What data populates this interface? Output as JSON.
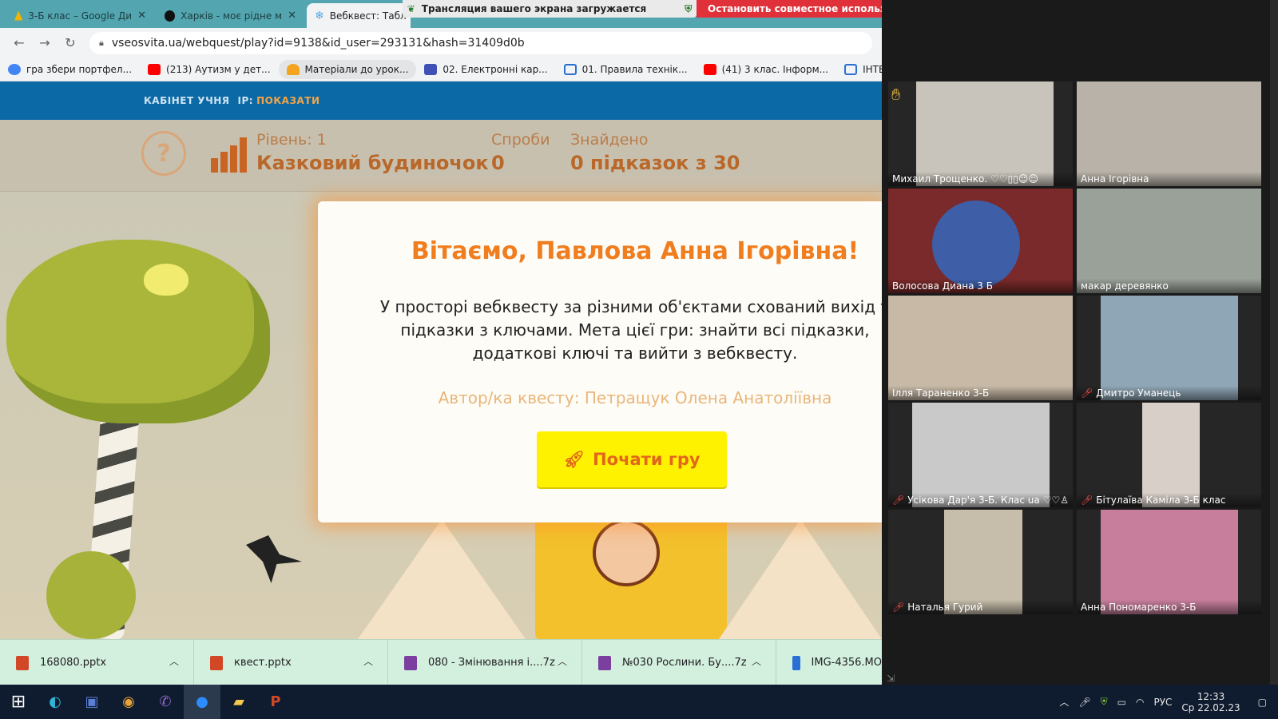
{
  "tabs": [
    {
      "label": "3-Б клас – Google Ди",
      "color": "#f2b400"
    },
    {
      "label": "Харків - моє рідне м",
      "color": "#111111"
    },
    {
      "label": "Вебквест: Табл",
      "color": "#5aa9e6"
    }
  ],
  "share_bar": {
    "text": "Трансляция вашего экрана загружается"
  },
  "stop_share": {
    "label": "Остановить совместное использова"
  },
  "omnibox": {
    "url": "vseosvita.ua/webquest/play?id=9138&id_user=293131&hash=31409d0b"
  },
  "bookmarks": [
    {
      "label": "гра збери портфел...",
      "icon": "google-icon",
      "color": "#4285f4"
    },
    {
      "label": "(213) Аутизм у дет...",
      "icon": "youtube-icon",
      "color": "#ff0000"
    },
    {
      "label": "Матеріали до урок...",
      "icon": "bell-icon",
      "color": "#f4a41e"
    },
    {
      "label": "02. Електронні кар...",
      "icon": "forms-icon",
      "color": "#3f51b5"
    },
    {
      "label": "01. Правила технік...",
      "icon": "board-icon",
      "color": "#2a6fd6"
    },
    {
      "label": "(41) 3 клас. Інформ...",
      "icon": "youtube-icon",
      "color": "#ff0000"
    },
    {
      "label": "ІНТЕРАКТИВНІ ВПР...",
      "icon": "board-icon",
      "color": "#2a6fd6"
    }
  ],
  "site_nav": {
    "cabinet": "КАБІНЕТ УЧНЯ",
    "ip_label": "IP:",
    "ip_link": "ПОКАЗАТИ"
  },
  "hud": {
    "help": "?",
    "level_label": "Рівень: 1",
    "level_name": "Казковий будиночок",
    "attempts_label": "Спроби",
    "attempts_value": "0",
    "found_label": "Знайдено",
    "found_value": "0 підказок з 30"
  },
  "modal": {
    "title": "Вітаємо, Павлова Анна Ігорівна!",
    "text": "У просторі вебквесту за різними об'єктами схований вихід т підказки з ключами. Мета цієї гри: знайти всі підказки, додаткові ключі та вийти з вебквесту.",
    "author": "Автор/ка квесту: Петращук Олена Анатоліївна",
    "start_label": "Почати гру"
  },
  "downloads": [
    {
      "name": "168080.pptx",
      "color": "#d24726"
    },
    {
      "name": "квест.pptx",
      "color": "#d24726"
    },
    {
      "name": "080 - Змінювання і....7z",
      "color": "#7b3fa0"
    },
    {
      "name": "№030 Рослини. Бу....7z",
      "color": "#7b3fa0"
    },
    {
      "name": "IMG-4356.MO",
      "color": "#2a6fd6"
    }
  ],
  "participants": [
    {
      "name": "Михаил Трощенко.",
      "extra": "♡♡▯▯☺☺",
      "muted": false,
      "hand": true,
      "bg": "#8b8f94",
      "video": "#c9c4bb"
    },
    {
      "name": "Анна Ігорівна",
      "extra": "",
      "muted": false,
      "hand": false,
      "bg": "#3b4a66",
      "video": "#b8b2a8"
    },
    {
      "name": "Волосова Диана 3 Б",
      "extra": "",
      "muted": false,
      "hand": false,
      "bg": "#7a2a2a",
      "video": "#3e5fa8"
    },
    {
      "name": "макар деревянко",
      "extra": "",
      "muted": false,
      "hand": false,
      "bg": "#6f7a73",
      "video": "#b9b8b1",
      "speaking": true
    },
    {
      "name": "Ілля Тараненко 3-Б",
      "extra": "",
      "muted": false,
      "hand": false,
      "bg": "#a89a8a",
      "video": "#c7b9a6"
    },
    {
      "name": "Дмитро Уманець",
      "extra": "",
      "muted": true,
      "hand": false,
      "bg": "#2d2d2d",
      "video": "#8fa6b6"
    },
    {
      "name": "Усікова Дар'я 3-Б. Клас ua",
      "extra": "♡♡♙",
      "muted": true,
      "hand": false,
      "bg": "#2d2d2d",
      "video": "#c9c9c9"
    },
    {
      "name": "Бітулаїва Каміла 3-Б клас",
      "extra": "",
      "muted": true,
      "hand": false,
      "bg": "#2d2d2d",
      "video": "#d8cfc9"
    },
    {
      "name": "Наталья Гурий",
      "extra": "",
      "muted": true,
      "hand": false,
      "bg": "#2d2d2d",
      "video": "#c6bdaa"
    },
    {
      "name": "Анна Пономаренко 3-Б",
      "extra": "",
      "muted": false,
      "hand": false,
      "bg": "#2d2d2d",
      "video": "#c77e9c"
    }
  ],
  "taskbar": {
    "apps": [
      {
        "icon": "windows-start-icon",
        "glyph": "⊞",
        "color": "#ffffff"
      },
      {
        "icon": "edge-icon",
        "glyph": "◐",
        "color": "#2fb4d6"
      },
      {
        "icon": "save-disk-icon",
        "glyph": "▣",
        "color": "#5b7fd6"
      },
      {
        "icon": "chrome-icon",
        "glyph": "◉",
        "color": "#e8a33a"
      },
      {
        "icon": "viber-icon",
        "glyph": "✆",
        "color": "#8b67c6"
      },
      {
        "icon": "zoom-icon",
        "glyph": "●",
        "color": "#2d8cff"
      },
      {
        "icon": "file-explorer-icon",
        "glyph": "▰",
        "color": "#f2c94c"
      },
      {
        "icon": "powerpoint-icon",
        "glyph": "P",
        "color": "#d24726"
      }
    ],
    "lang": "РУС",
    "time": "12:33",
    "date": "Ср 22.02.23"
  }
}
